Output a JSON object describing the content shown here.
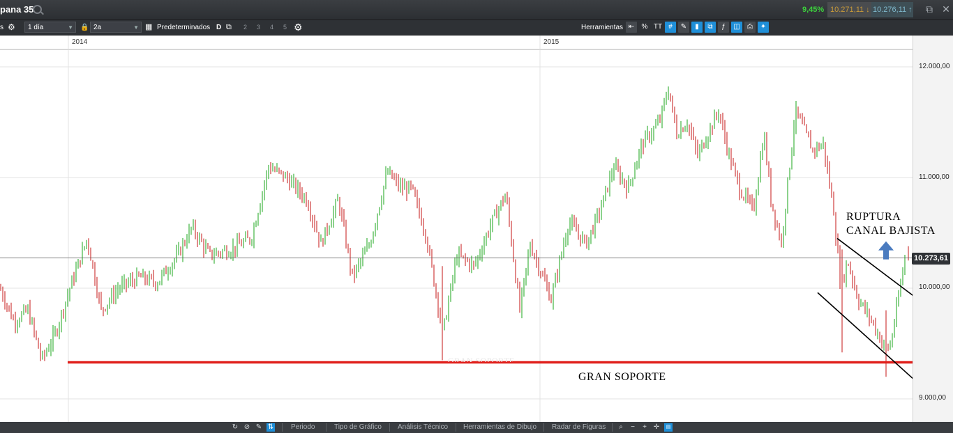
{
  "topbar": {
    "title": "pana 35",
    "change_pct": "9,45%",
    "bid": "10.271,11",
    "ask": "10.276,11",
    "colors": {
      "up": "#3cd23c",
      "bid": "#c89a3a",
      "ask": "#7fb8cc"
    }
  },
  "toolbar": {
    "left_label": "s",
    "interval": "1 día",
    "range": "2a",
    "presets_label": "Predeterminados",
    "d_label": "D",
    "slots": [
      "2",
      "3",
      "4",
      "5"
    ],
    "tools_label": "Herramientas",
    "percent_label": "%",
    "text_tool_label": "TT"
  },
  "chart": {
    "years": [
      "2014",
      "2015"
    ],
    "y_ticks": [
      "12.000,00",
      "11.000,00",
      "10.000,00",
      "9.000,00"
    ],
    "last_price": "10.273,61",
    "annotations": {
      "breakout": [
        "RUPTURA",
        "CANAL BAJISTA"
      ],
      "support": "GRAN SOPORTE",
      "faded_label": "GRAN SOPORTE"
    },
    "colors": {
      "bull": "#1aa61a",
      "bear": "#c41616",
      "support": "#e0201c",
      "arrow": "#4a7bbf"
    }
  },
  "chart_data": {
    "type": "candlestick",
    "title": "",
    "xlabel": "",
    "ylabel": "",
    "ylim": [
      8850,
      12100
    ],
    "y_tick_values": [
      9000,
      10000,
      11000,
      12000
    ],
    "x_year_labels": [
      "2014",
      "2015"
    ],
    "last_price": 10273.61,
    "price_path": [
      [
        0,
        10000
      ],
      [
        20,
        9700
      ],
      [
        40,
        9800
      ],
      [
        60,
        9350
      ],
      [
        80,
        9600
      ],
      [
        100,
        10000
      ],
      [
        125,
        10450
      ],
      [
        145,
        9800
      ],
      [
        170,
        10000
      ],
      [
        200,
        10100
      ],
      [
        225,
        10050
      ],
      [
        255,
        10300
      ],
      [
        275,
        10550
      ],
      [
        300,
        10300
      ],
      [
        330,
        10350
      ],
      [
        360,
        10450
      ],
      [
        385,
        11100
      ],
      [
        410,
        11000
      ],
      [
        440,
        10800
      ],
      [
        460,
        10400
      ],
      [
        485,
        10800
      ],
      [
        505,
        10100
      ],
      [
        530,
        10400
      ],
      [
        555,
        11050
      ],
      [
        575,
        10900
      ],
      [
        590,
        10900
      ],
      [
        610,
        10500
      ],
      [
        635,
        9600
      ],
      [
        655,
        10300
      ],
      [
        680,
        10200
      ],
      [
        705,
        10600
      ],
      [
        725,
        10850
      ],
      [
        745,
        9800
      ],
      [
        760,
        10400
      ],
      [
        790,
        9900
      ],
      [
        815,
        10600
      ],
      [
        840,
        10400
      ],
      [
        860,
        10700
      ],
      [
        880,
        11100
      ],
      [
        900,
        10900
      ],
      [
        920,
        11300
      ],
      [
        945,
        11500
      ],
      [
        958,
        11800
      ],
      [
        970,
        11400
      ],
      [
        985,
        11500
      ],
      [
        1000,
        11200
      ],
      [
        1030,
        11600
      ],
      [
        1045,
        11200
      ],
      [
        1060,
        10900
      ],
      [
        1080,
        10700
      ],
      [
        1095,
        11400
      ],
      [
        1105,
        10800
      ],
      [
        1120,
        10400
      ],
      [
        1140,
        11600
      ],
      [
        1165,
        11250
      ],
      [
        1180,
        11300
      ],
      [
        1195,
        10700
      ],
      [
        1205,
        10000
      ],
      [
        1215,
        10250
      ],
      [
        1230,
        9900
      ],
      [
        1250,
        9700
      ],
      [
        1265,
        9500
      ],
      [
        1275,
        9450
      ],
      [
        1285,
        9800
      ],
      [
        1297,
        10280
      ]
    ],
    "support_level": 9330,
    "channel_upper": [
      [
        1200,
        10450
      ],
      [
        1360,
        9690
      ]
    ],
    "channel_lower": [
      [
        1172,
        9960
      ],
      [
        1318,
        9130
      ]
    ],
    "breakout_arrow": "up"
  }
}
